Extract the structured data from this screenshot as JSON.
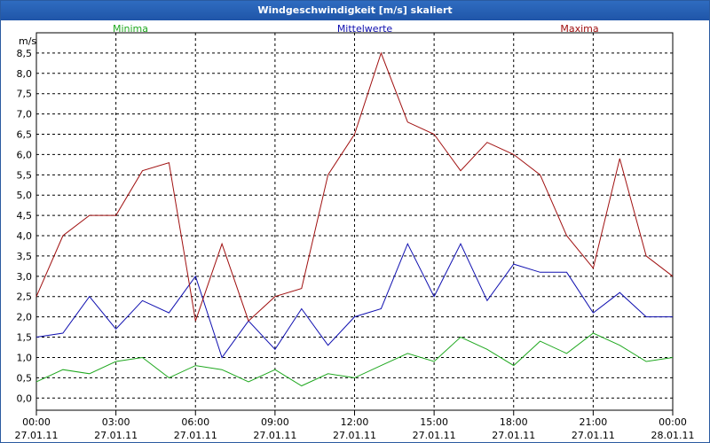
{
  "window": {
    "title": "Windgeschwindigkeit [m/s] skaliert"
  },
  "chart_data": {
    "type": "line",
    "title": "Windgeschwindigkeit [m/s] skaliert",
    "ylabel": "m/s",
    "ylim": [
      -0.3,
      9.0
    ],
    "y_ticks": [
      "0,0",
      "0,5",
      "1,0",
      "1,5",
      "2,0",
      "2,5",
      "3,0",
      "3,5",
      "4,0",
      "4,5",
      "5,0",
      "5,5",
      "6,0",
      "6,5",
      "7,0",
      "7,5",
      "8,0",
      "8,5"
    ],
    "y_tick_values": [
      0,
      0.5,
      1,
      1.5,
      2,
      2.5,
      3,
      3.5,
      4,
      4.5,
      5,
      5.5,
      6,
      6.5,
      7,
      7.5,
      8,
      8.5
    ],
    "x_range_hours": [
      0,
      24
    ],
    "x_tick_times": [
      "00:00",
      "03:00",
      "06:00",
      "09:00",
      "12:00",
      "15:00",
      "18:00",
      "21:00",
      "00:00"
    ],
    "x_tick_dates": [
      "27.01.11",
      "27.01.11",
      "27.01.11",
      "27.01.11",
      "27.01.11",
      "27.01.11",
      "27.01.11",
      "27.01.11",
      "28.01.11"
    ],
    "grid": true,
    "legend_position": "top",
    "series": [
      {
        "name": "Minima",
        "color": "#1fa81f",
        "x": [
          0,
          1,
          2,
          3,
          4,
          5,
          6,
          7,
          8,
          9,
          10,
          11,
          12,
          13,
          14,
          15,
          16,
          17,
          18,
          19,
          20,
          21,
          22,
          23,
          24
        ],
        "values": [
          0.4,
          0.7,
          0.6,
          0.9,
          1.0,
          0.5,
          0.8,
          0.7,
          0.4,
          0.7,
          0.3,
          0.6,
          0.5,
          0.8,
          1.1,
          0.9,
          1.5,
          1.2,
          0.8,
          1.4,
          1.1,
          1.6,
          1.3,
          0.9,
          1.0
        ]
      },
      {
        "name": "Mittelwerte",
        "color": "#1010b0",
        "x": [
          0,
          1,
          2,
          3,
          4,
          5,
          6,
          7,
          8,
          9,
          10,
          11,
          12,
          13,
          14,
          15,
          16,
          17,
          18,
          19,
          20,
          21,
          22,
          23,
          24
        ],
        "values": [
          1.5,
          1.6,
          2.5,
          1.7,
          2.4,
          2.1,
          3.0,
          1.0,
          1.9,
          1.2,
          2.2,
          1.3,
          2.0,
          2.2,
          3.8,
          2.5,
          3.8,
          2.4,
          3.3,
          3.1,
          3.1,
          2.1,
          2.6,
          2.0,
          2.0
        ]
      },
      {
        "name": "Maxima",
        "color": "#a01010",
        "x": [
          0,
          1,
          2,
          3,
          4,
          5,
          6,
          7,
          8,
          9,
          10,
          11,
          12,
          13,
          14,
          15,
          16,
          17,
          18,
          19,
          20,
          21,
          22,
          23,
          24
        ],
        "values": [
          2.5,
          4.0,
          4.5,
          4.5,
          5.6,
          5.8,
          1.9,
          3.8,
          1.9,
          2.5,
          2.7,
          5.5,
          6.5,
          8.5,
          6.8,
          6.5,
          5.6,
          6.3,
          6.0,
          5.5,
          4.0,
          3.2,
          5.9,
          3.5,
          3.0
        ]
      }
    ]
  }
}
